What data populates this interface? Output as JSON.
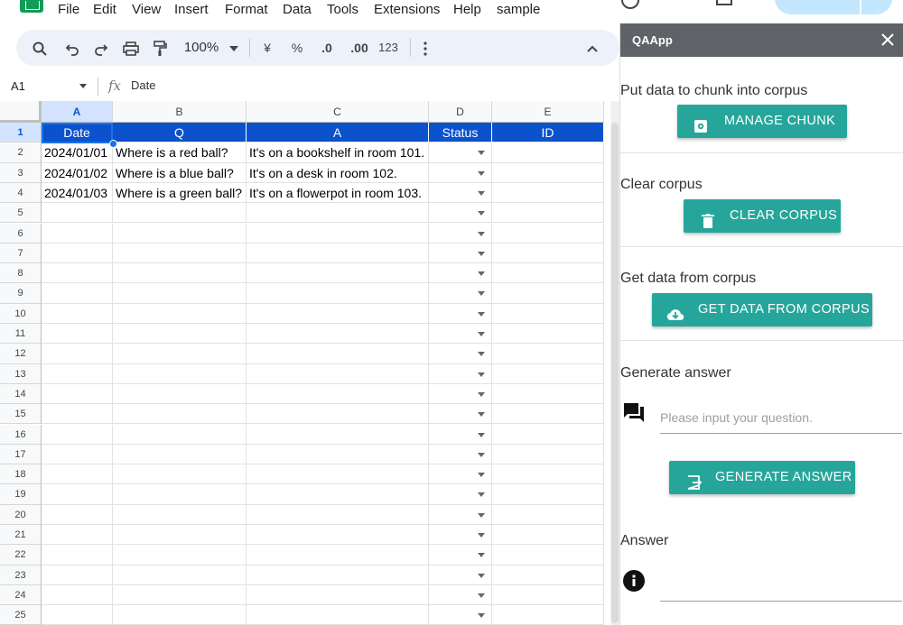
{
  "menu": {
    "items": [
      "File",
      "Edit",
      "View",
      "Insert",
      "Format",
      "Data",
      "Tools",
      "Extensions",
      "Help"
    ],
    "doc_title": "sample"
  },
  "toolbar": {
    "zoom": "100%",
    "currency": "¥",
    "percent": "%",
    "dec_decrease": ".0",
    "dec_increase": ".00",
    "number_format": "123"
  },
  "formula_bar": {
    "name_box": "A1",
    "fx": "fx",
    "content": "Date"
  },
  "sheet": {
    "column_headers": [
      "A",
      "B",
      "C",
      "D",
      "E"
    ],
    "header_row": [
      "Date",
      "Q",
      "A",
      "Status",
      "ID"
    ],
    "rows": [
      [
        "2024/01/01",
        "Where is a red ball?",
        "It's on a bookshelf in room 101.",
        "",
        ""
      ],
      [
        "2024/01/02",
        "Where is a blue ball?",
        "It's on a desk in room 102.",
        "",
        ""
      ],
      [
        "2024/01/03",
        "Where is a green ball?",
        "It's on a flowerpot in room 103.",
        "",
        ""
      ]
    ],
    "row_numbers": [
      "1",
      "2",
      "3",
      "4",
      "5",
      "6",
      "7",
      "8",
      "9",
      "10",
      "11",
      "12",
      "13",
      "14",
      "15",
      "16",
      "17",
      "18",
      "19",
      "20",
      "21",
      "22",
      "23",
      "24",
      "25"
    ]
  },
  "sidebar": {
    "title": "QAApp",
    "sections": {
      "chunk_label": "Put data to chunk into corpus",
      "chunk_button": "MANAGE CHUNK",
      "clear_label": "Clear corpus",
      "clear_button": "CLEAR CORPUS",
      "get_label": "Get data from corpus",
      "get_button": "GET DATA FROM CORPUS",
      "generate_label": "Generate answer",
      "question_placeholder": "Please input your question.",
      "generate_button": "GENERATE ANSWER",
      "answer_label": "Answer"
    }
  },
  "colors": {
    "header_fill": "#0b52cc",
    "button": "#26a69a",
    "sidebar_header": "#5f6368",
    "toolbar_bg": "#edf2fa"
  }
}
